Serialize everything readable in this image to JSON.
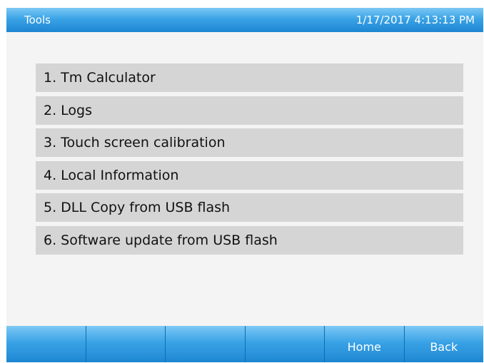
{
  "header": {
    "title": "Tools",
    "datetime": "1/17/2017 4:13:13 PM"
  },
  "menu": {
    "items": [
      {
        "label": "1. Tm Calculator"
      },
      {
        "label": "2. Logs"
      },
      {
        "label": "3. Touch screen calibration"
      },
      {
        "label": "4. Local Information"
      },
      {
        "label": "5. DLL Copy from USB flash"
      },
      {
        "label": "6. Software update from USB flash"
      }
    ]
  },
  "footer": {
    "buttons": [
      {
        "label": ""
      },
      {
        "label": ""
      },
      {
        "label": ""
      },
      {
        "label": ""
      },
      {
        "label": "Home"
      },
      {
        "label": "Back"
      }
    ]
  },
  "colors": {
    "header_blue": "#3aa3e6",
    "menu_item_bg": "#d5d5d5",
    "screen_bg": "#f4f4f4"
  }
}
